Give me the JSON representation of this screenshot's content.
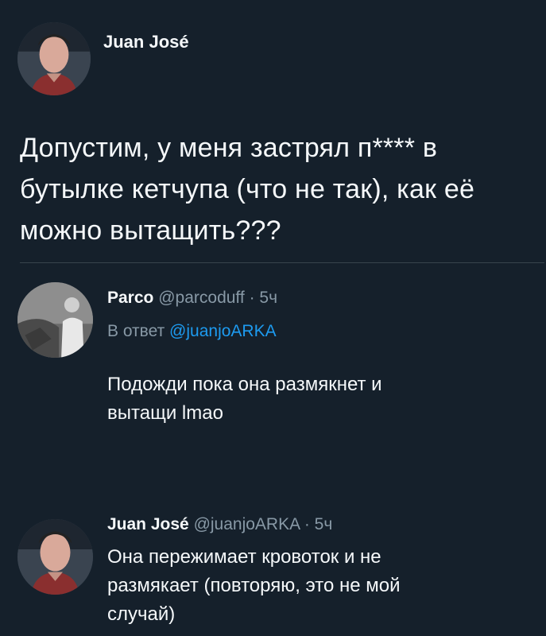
{
  "original_tweet": {
    "author_name": "Juan José",
    "avatar": "profile-photo-man",
    "text_lines": [
      "Допустим, у меня застрял п**** в",
      "бутылке кетчупа (что не так), как её",
      "можно вытащить???"
    ]
  },
  "reply_1": {
    "author_name": "Parco",
    "handle": "@parcoduff",
    "time": "· 5ч",
    "reply_prefix": "В ответ",
    "reply_handle": "@juanjoARKA",
    "avatar": "profile-photo-grayscale",
    "text_lines": [
      "Подожди пока она размякнет и",
      "вытащи lmao"
    ]
  },
  "reply_2": {
    "author_name": "Juan José",
    "handle": "@juanjoARKA",
    "time": "· 5ч",
    "avatar": "profile-photo-man",
    "text_lines": [
      "Она пережимает кровоток и не",
      "размякает (повторяю, это не мой",
      "случай)"
    ]
  },
  "colors": {
    "background": "#15202b",
    "text": "#f5f8fa",
    "secondary": "#8899a6",
    "link": "#1d9bf0"
  }
}
